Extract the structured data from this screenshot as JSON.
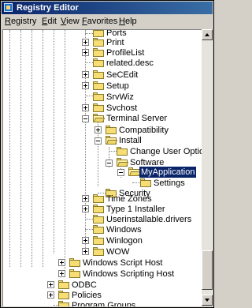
{
  "window": {
    "title": "Registry Editor"
  },
  "menu": [
    {
      "key": "R",
      "rest": "egistry"
    },
    {
      "key": "E",
      "rest": "dit"
    },
    {
      "key": "V",
      "rest": "iew"
    },
    {
      "key": "F",
      "rest": "avorites"
    },
    {
      "key": "H",
      "rest": "elp"
    }
  ],
  "tree": {
    "ports": "Ports",
    "print": "Print",
    "profilelist": "ProfileList",
    "related_desc": "related.desc",
    "secedit": "SeCEdit",
    "setup": "Setup",
    "srvwiz": "SrvWiz",
    "svchost": "Svchost",
    "terminal_server": "Terminal Server",
    "compatibility": "Compatibility",
    "install": "Install",
    "change_user_option": "Change User Option",
    "software": "Software",
    "myapplication": "MyApplication",
    "settings": "Settings",
    "security": "Security",
    "time_zones": "Time Zones",
    "type1_installer": "Type 1 Installer",
    "userinstallable_drivers": "Userinstallable.drivers",
    "windows": "Windows",
    "winlogon": "Winlogon",
    "wow": "WOW",
    "windows_script_host": "Windows Script Host",
    "windows_scripting_host": "Windows Scripting Host",
    "odbc": "ODBC",
    "policies": "Policies",
    "program_groups": "Program Groups"
  }
}
